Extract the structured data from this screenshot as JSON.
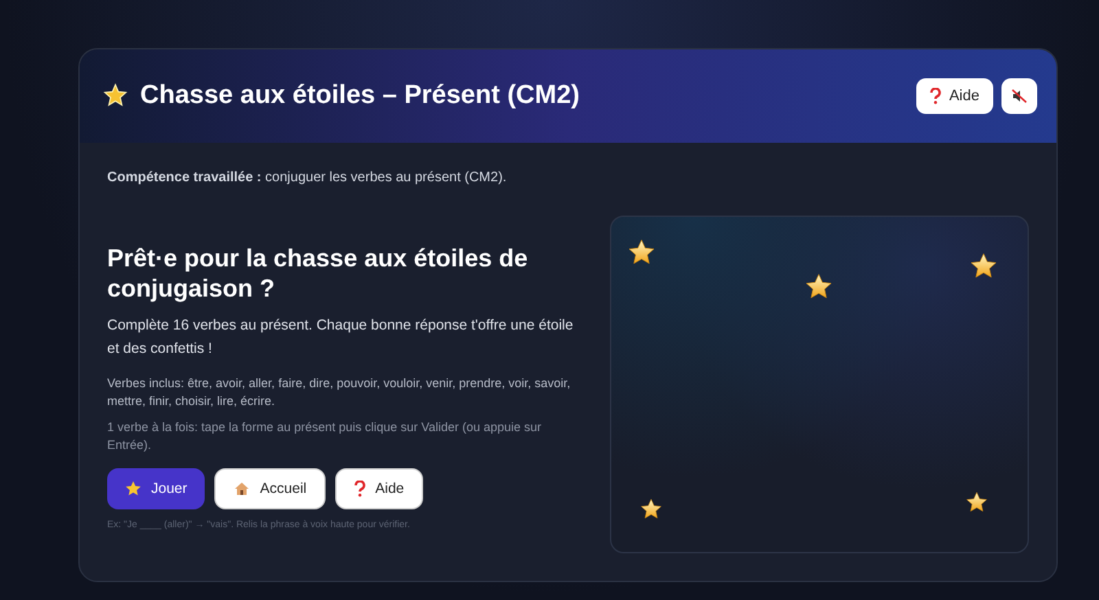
{
  "header": {
    "title": "Chasse aux étoiles – Présent (CM2)",
    "help_button": "Aide"
  },
  "skill": "**Compétence travaillée :** conjuguer les verbes au présent (CM2).",
  "intro": {
    "heading": "Prêt·e pour la chasse aux étoiles de conjugaison ?",
    "lead": "Complète 16 verbes au présent. Chaque bonne réponse t'offre une étoile et des confettis !",
    "verbs": "Verbes inclus: être, avoir, aller, faire, dire, pouvoir, vouloir, venir, prendre, voir, savoir, mettre, finir, choisir, lire, écrire.",
    "instructions": "1 verbe à la fois: tape la forme au présent puis clique sur Valider (ou appuie sur Entrée).",
    "buttons": [
      {
        "kind": "primary",
        "label": "Jouer"
      },
      {
        "kind": "secondary",
        "label": "Accueil"
      },
      {
        "kind": "secondary",
        "label": "Aide"
      }
    ],
    "example": "Ex: \"Je ____ (aller)\" → \"vais\". Relis la phrase à voix haute pour vérifier."
  }
}
